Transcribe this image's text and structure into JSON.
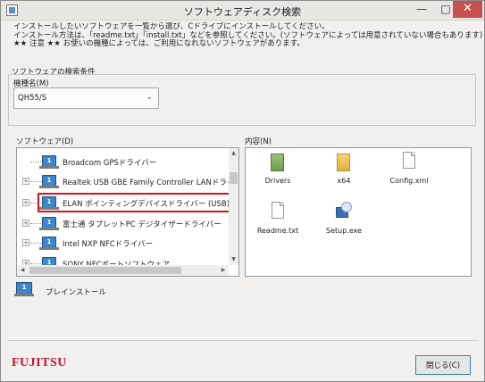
{
  "window": {
    "title": "ソフトウェアディスク検索",
    "minimize_glyph": "—",
    "maximize_glyph": "□",
    "close_glyph": "✕"
  },
  "intro": {
    "line1": "インストールしたいソフトウェアを一覧から選び、Cドライブにインストールしてください。",
    "line2": "インストール方法は、「readme.txt」「install.txt」などを参照してください。(ソフトウェアによっては用意されていない場合もあります)",
    "line3": "★★ 注意 ★★ お使いの機種によっては、ご利用になれないソフトウェアがあります。"
  },
  "search": {
    "group_label": "ソフトウェアの検索条件",
    "model_label": "機種名(M)",
    "model_value": "QH55/S"
  },
  "software_list": {
    "label": "ソフトウェア(D)",
    "items": [
      {
        "label": "Broadcom GPSドライバー",
        "expandable": false
      },
      {
        "label": "Realtek USB GBE Family Controller LANドライバー",
        "expandable": true
      },
      {
        "label": "ELAN ポインティングデバイスドライバー (USB)",
        "expandable": true,
        "selected": true
      },
      {
        "label": "富士通 タブレットPC デジタイザードライバー",
        "expandable": true
      },
      {
        "label": "Intel NXP NFCドライバー",
        "expandable": true
      },
      {
        "label": "SONY NFCポートソフトウェア",
        "expandable": true
      }
    ],
    "icon_text": "1",
    "expander_glyph": "+"
  },
  "contents": {
    "label": "内容(N)",
    "files": [
      {
        "label": "Drivers",
        "icon": "folder-green-icon"
      },
      {
        "label": "x64",
        "icon": "folder-icon"
      },
      {
        "label": "Config.xml",
        "icon": "document-icon"
      },
      {
        "label": "Readme.txt",
        "icon": "document-icon"
      },
      {
        "label": "Setup.exe",
        "icon": "setup-icon"
      }
    ]
  },
  "legend": {
    "preinstall_label": "プレインストール",
    "icon_text": "1"
  },
  "footer": {
    "logo_text": "FUJITSU",
    "close_button_label": "閉じる(C)"
  },
  "colors": {
    "selection_border": "#d4141c",
    "logo": "#c8102e",
    "close_titlebar": "#c75050",
    "install_icon": "#3c86c9"
  }
}
